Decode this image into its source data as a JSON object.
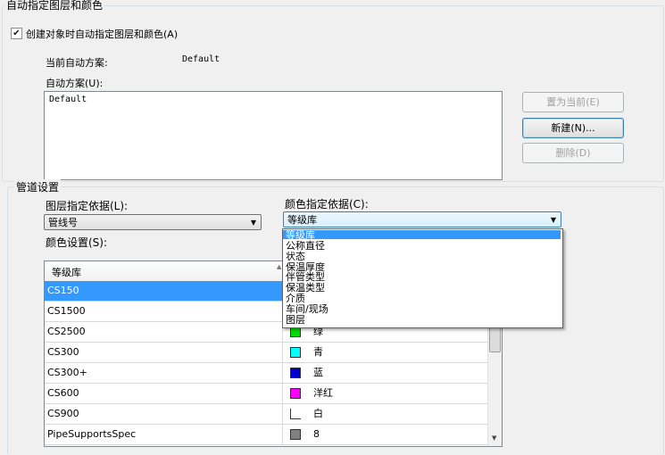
{
  "auto_group": {
    "title": "自动指定图层和颜色",
    "checkbox_label": "创建对象时自动指定图层和颜色(A)",
    "checked": true,
    "current_scheme_label": "当前自动方案:",
    "current_scheme_value": "Default",
    "schemes_label": "自动方案(U):",
    "schemes": [
      "Default"
    ],
    "buttons": {
      "set_current": "置为当前(E)",
      "new": "新建(N)...",
      "delete": "删除(D)"
    }
  },
  "pipe_group": {
    "title": "管道设置",
    "layer_basis_label": "图层指定依据(L):",
    "layer_basis_value": "管线号",
    "color_basis_label": "颜色指定依据(C):",
    "color_basis_value": "等级库",
    "color_settings_label": "颜色设置(S):",
    "table_header": "等级库",
    "rows": [
      {
        "name": "CS150",
        "color": "",
        "label": "",
        "selected": true
      },
      {
        "name": "CS1500",
        "color": "",
        "label": ""
      },
      {
        "name": "CS2500",
        "color": "#00e000",
        "label": "绿"
      },
      {
        "name": "CS300",
        "color": "#00ffff",
        "label": "青"
      },
      {
        "name": "CS300+",
        "color": "#0000cc",
        "label": "蓝"
      },
      {
        "name": "CS600",
        "color": "#ff00ff",
        "label": "洋红"
      },
      {
        "name": "CS900",
        "color": "#ffffff",
        "label": "白"
      },
      {
        "name": "PipeSupportsSpec",
        "color": "#808080",
        "label": "8"
      }
    ],
    "dropdown_options": [
      "等级库",
      "公称直径",
      "状态",
      "保温厚度",
      "伴管类型",
      "保温类型",
      "介质",
      "车间/现场",
      "图层"
    ],
    "dropdown_selected": 0
  },
  "colors": {
    "selection": "#3399ff",
    "group_border": "#d5dfe5"
  }
}
